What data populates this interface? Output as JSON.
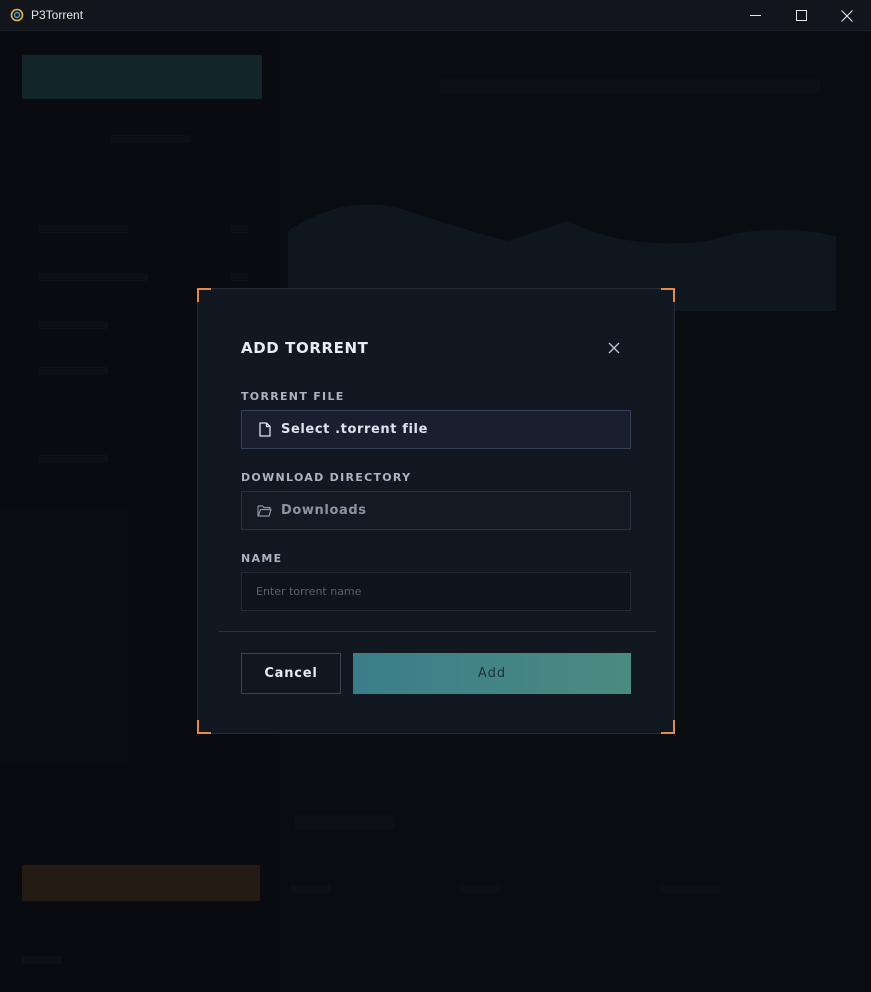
{
  "window": {
    "title": "P3Torrent"
  },
  "dialog": {
    "title": "ADD TORRENT",
    "torrent_file": {
      "label": "TORRENT FILE",
      "value": "Select .torrent file"
    },
    "download_directory": {
      "label": "DOWNLOAD DIRECTORY",
      "value": "Downloads"
    },
    "name": {
      "label": "NAME",
      "placeholder": "Enter torrent name",
      "value": ""
    },
    "buttons": {
      "cancel": "Cancel",
      "add": "Add"
    }
  },
  "colors": {
    "accent_corner": "#e38a4c",
    "primary_button": "#3a7e8a",
    "dialog_bg": "#121821"
  },
  "icons": {
    "app": "p3torrent-logo",
    "file": "file-icon",
    "folder": "folder-icon",
    "close": "close-icon"
  }
}
